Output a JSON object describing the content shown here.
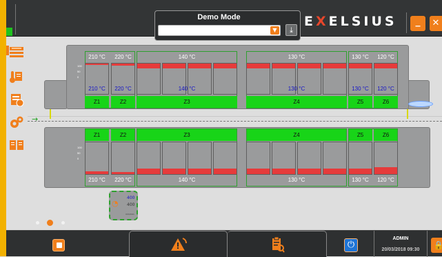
{
  "demo": {
    "label": "Demo Mode",
    "value": ""
  },
  "brand": {
    "logo_pre": "E",
    "logo_x": "X",
    "logo_post": "ELSIUS"
  },
  "sidebar": {
    "items": [
      {
        "name": "process-icon"
      },
      {
        "name": "temperature-edit-icon"
      },
      {
        "name": "recipe-check-icon"
      },
      {
        "name": "settings-gears-icon"
      },
      {
        "name": "manual-book-icon"
      }
    ]
  },
  "zones": {
    "top": {
      "labels": [
        "Z1",
        "Z2",
        "Z3",
        "Z4",
        "Z5",
        "Z6"
      ],
      "setpoints": [
        "210",
        "220",
        "140",
        "130",
        "130",
        "120"
      ],
      "actuals": [
        "210",
        "220",
        "140",
        "130",
        "130",
        "120"
      ],
      "unit": "°C",
      "fill": [
        0.0,
        0.07,
        0.2,
        0.2,
        0.2,
        0.2,
        0.2,
        0.2,
        0.2,
        0.2,
        0.2,
        0.2
      ]
    },
    "bottom": {
      "labels": [
        "Z1",
        "Z2",
        "Z3",
        "Z4",
        "Z5",
        "Z6"
      ],
      "setpoints": [
        "210",
        "220",
        "140",
        "130",
        "130",
        "120"
      ],
      "unit": "°C",
      "fill": [
        0.1,
        0.05,
        0.2,
        0.2,
        0.2,
        0.2,
        0.2,
        0.2,
        0.2,
        0.2,
        0.2,
        0.25
      ]
    },
    "scale": [
      "100",
      "50",
      "0"
    ]
  },
  "conveyor": {
    "setpoint": "400",
    "actual": "400",
    "unit": "mm/min"
  },
  "user": {
    "name": "ADMIN",
    "datetime": "20/03/2018 09:30"
  },
  "colors": {
    "accent": "#f07f1c",
    "zone_active": "#18d418",
    "heater": "#e63b3b",
    "temp_actual": "#1515c8"
  }
}
